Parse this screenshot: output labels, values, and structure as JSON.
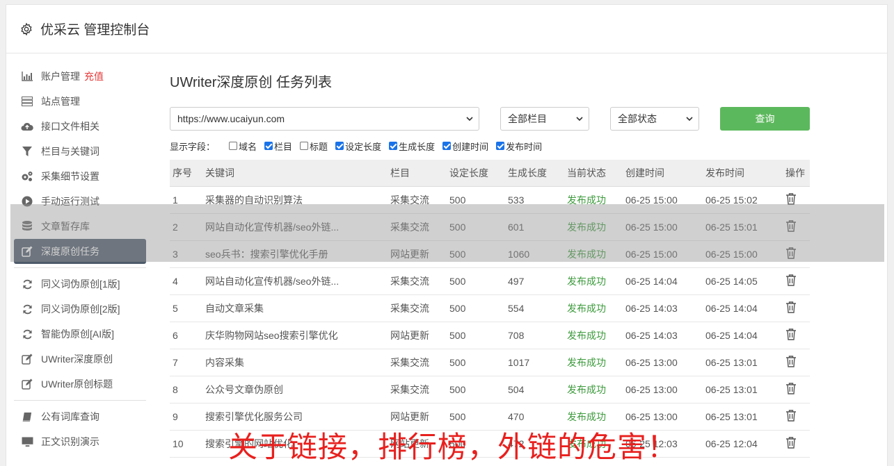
{
  "header": {
    "title": "优采云 管理控制台"
  },
  "sidebar": {
    "items": [
      {
        "label": "账户管理",
        "extra": "充值",
        "icon": "bar-chart-icon"
      },
      {
        "label": "站点管理",
        "icon": "server-icon"
      },
      {
        "label": "接口文件相关",
        "icon": "cloud-upload-icon"
      },
      {
        "label": "栏目与关键词",
        "icon": "filter-icon"
      },
      {
        "label": "采集细节设置",
        "icon": "gears-icon"
      },
      {
        "label": "手动运行测试",
        "icon": "play-icon"
      },
      {
        "label": "文章暂存库",
        "icon": "database-icon"
      },
      {
        "label": "深度原创任务",
        "icon": "edit-icon",
        "active": true
      }
    ],
    "items2": [
      {
        "label": "同义词伪原创[1版]",
        "icon": "refresh-icon"
      },
      {
        "label": "同义词伪原创[2版]",
        "icon": "refresh-icon"
      },
      {
        "label": "智能伪原创[AI版]",
        "icon": "refresh-icon"
      },
      {
        "label": "UWriter深度原创",
        "icon": "edit-icon"
      },
      {
        "label": "UWriter原创标题",
        "icon": "edit-icon"
      }
    ],
    "items3": [
      {
        "label": "公有词库查询",
        "icon": "book-icon"
      },
      {
        "label": "正文识别演示",
        "icon": "monitor-icon"
      }
    ]
  },
  "main": {
    "title": "UWriter深度原创 任务列表",
    "site_select": "https://www.ucaiyun.com",
    "column_select": "全部栏目",
    "status_select": "全部状态",
    "query_label": "查询",
    "fields_label": "显示字段：",
    "fields": [
      {
        "label": "域名",
        "checked": false
      },
      {
        "label": "栏目",
        "checked": true
      },
      {
        "label": "标题",
        "checked": false
      },
      {
        "label": "设定长度",
        "checked": true
      },
      {
        "label": "生成长度",
        "checked": true
      },
      {
        "label": "创建时间",
        "checked": true
      },
      {
        "label": "发布时间",
        "checked": true
      }
    ],
    "columns": [
      "序号",
      "关键词",
      "栏目",
      "设定长度",
      "生成长度",
      "当前状态",
      "创建时间",
      "发布时间",
      "操作"
    ],
    "rows": [
      [
        "1",
        "采集器的自动识别算法",
        "采集交流",
        "500",
        "533",
        "发布成功",
        "06-25 15:00",
        "06-25 15:02"
      ],
      [
        "2",
        "网站自动化宣传机器/seo外链...",
        "采集交流",
        "500",
        "601",
        "发布成功",
        "06-25 15:00",
        "06-25 15:01"
      ],
      [
        "3",
        "seo兵书：搜索引擎优化手册",
        "网站更新",
        "500",
        "1060",
        "发布成功",
        "06-25 15:00",
        "06-25 15:00"
      ],
      [
        "4",
        "网站自动化宣传机器/seo外链...",
        "采集交流",
        "500",
        "497",
        "发布成功",
        "06-25 14:04",
        "06-25 14:05"
      ],
      [
        "5",
        "自动文章采集",
        "采集交流",
        "500",
        "554",
        "发布成功",
        "06-25 14:03",
        "06-25 14:04"
      ],
      [
        "6",
        "庆华购物网站seo搜索引擎优化",
        "网站更新",
        "500",
        "708",
        "发布成功",
        "06-25 14:03",
        "06-25 14:04"
      ],
      [
        "7",
        "内容采集",
        "采集交流",
        "500",
        "1017",
        "发布成功",
        "06-25 13:00",
        "06-25 13:01"
      ],
      [
        "8",
        "公众号文章伪原创",
        "采集交流",
        "500",
        "504",
        "发布成功",
        "06-25 13:00",
        "06-25 13:01"
      ],
      [
        "9",
        "搜索引擎优化服务公司",
        "网站更新",
        "500",
        "470",
        "发布成功",
        "06-25 13:00",
        "06-25 13:01"
      ],
      [
        "10",
        "搜索引擎的网站优化",
        "网站更新",
        "500",
        "472",
        "发布成功",
        "06-25 12:03",
        "06-25 12:04"
      ]
    ]
  },
  "overlay_caption": "关于链接，排行榜，外链的危害！",
  "colors": {
    "query_button": "#5cb85c",
    "status_ok": "#3c9a3c",
    "active_nav": "#4e5a6a",
    "caption": "#e8201e",
    "recharge": "#e43a3a"
  }
}
